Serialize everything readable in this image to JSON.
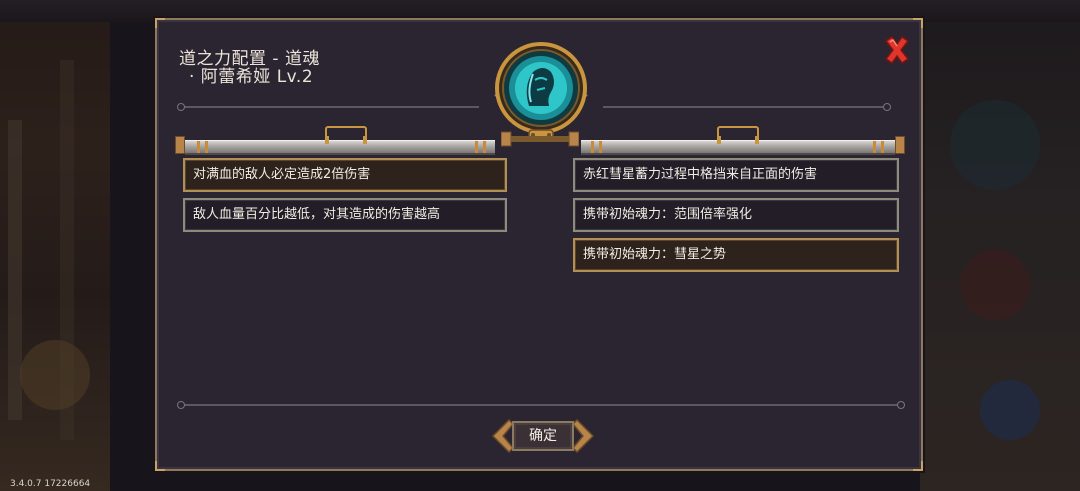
{
  "dialog": {
    "title_line1": "道之力配置 - 道魂",
    "title_line2": "· 阿蕾希娅 Lv.2",
    "close_icon": "close-x-icon",
    "confirm_label": "确定"
  },
  "left_effects": [
    {
      "text": "对满血的敌人必定造成2倍伤害",
      "selected": true
    },
    {
      "text": "敌人血量百分比越低，对其造成的伤害越高",
      "selected": false
    }
  ],
  "right_effects": [
    {
      "text": "赤红彗星蓄力过程中格挡来自正面的伤害",
      "selected": false
    },
    {
      "text": "携带初始魂力：范围倍率强化",
      "selected": false
    },
    {
      "text": "携带初始魂力：彗星之势",
      "selected": true
    }
  ],
  "colors": {
    "panel_bg": "#2b2531",
    "gold_accent": "#c9953e",
    "medallion_teal": "#2ec6c9",
    "close_red": "#e0352b"
  },
  "version": "3.4.0.7 17226664"
}
